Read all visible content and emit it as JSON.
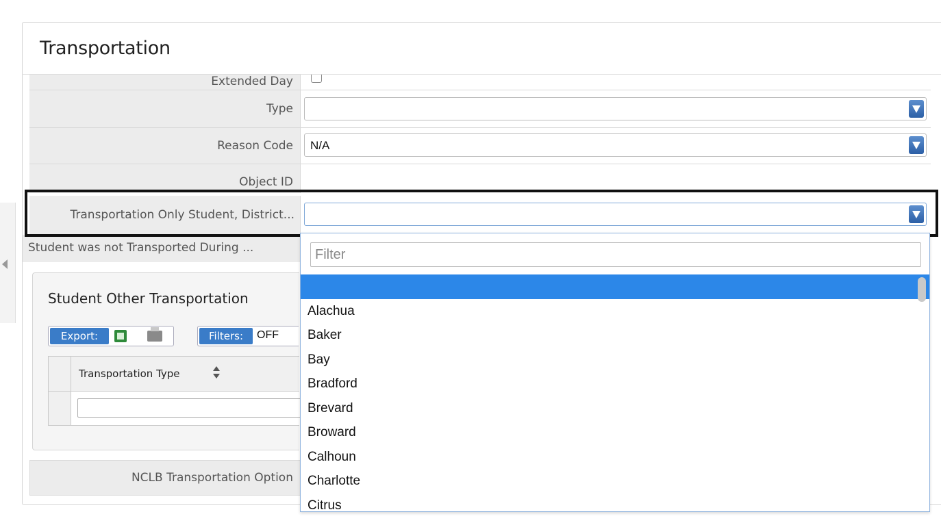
{
  "panel": {
    "title": "Transportation"
  },
  "fields": {
    "extended_day": {
      "label": "Extended Day",
      "checked": false
    },
    "type": {
      "label": "Type",
      "value": ""
    },
    "reason_code": {
      "label": "Reason Code",
      "value": "N/A"
    },
    "object_id": {
      "label": "Object ID",
      "value": ""
    },
    "transport_only": {
      "label": "Transportation Only Student, District...",
      "value": ""
    },
    "not_transported": {
      "label": "Student was not Transported During ..."
    }
  },
  "other_transportation": {
    "title": "Student Other Transportation",
    "export_label": "Export:",
    "filters_label": "Filters:",
    "filters_state": "OFF",
    "column_header": "Transportation Type"
  },
  "nclb": {
    "label": "NCLB Transportation Option"
  },
  "dropdown": {
    "filter_placeholder": "Filter",
    "options": [
      "",
      "Alachua",
      "Baker",
      "Bay",
      "Bradford",
      "Brevard",
      "Broward",
      "Calhoun",
      "Charlotte",
      "Citrus"
    ],
    "selected_index": 0
  },
  "colors": {
    "accent": "#2c87e8",
    "select_button": "#3a6fb8",
    "highlight_border": "#111111"
  }
}
